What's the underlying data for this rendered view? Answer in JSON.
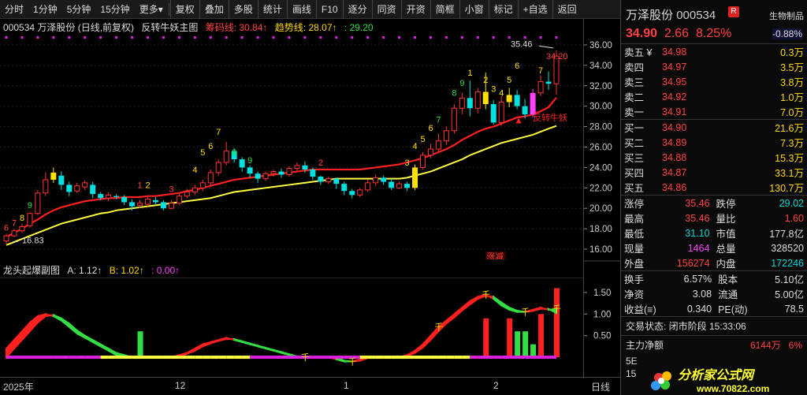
{
  "toolbar": {
    "items": [
      "分时",
      "1分钟",
      "5分钟",
      "15分钟",
      "更多"
    ],
    "more_arrow": "▾",
    "tools": [
      "复权",
      "叠加",
      "多股",
      "统计",
      "画线",
      "F10",
      "逐分",
      "同资",
      "开资",
      "简框",
      "小窗",
      "标记",
      "+自选",
      "返回"
    ]
  },
  "main": {
    "title": "000534 万泽股份 (日线,前复权)",
    "indicator": "反转牛妖主图",
    "line1": "筹码线: 30.84↑",
    "line2": "趋势线: 28.07↑",
    "line3": ": 29.20",
    "label_high": "35.46",
    "label_low": "16.83",
    "signal": "反转牛妖",
    "tag": "涨减",
    "nums": [
      "6",
      "7",
      "8",
      "9",
      "1",
      "2",
      "3",
      "4",
      "5",
      "6",
      "7",
      "8",
      "9",
      "2",
      "3",
      "4",
      "5",
      "6",
      "7",
      "8",
      "9",
      "1",
      "2",
      "3",
      "4",
      "5",
      "6",
      "7",
      "34.20"
    ],
    "arrow_up": "▲"
  },
  "sub": {
    "title": "龙头起爆副图",
    "a": "A: 1.12↑",
    "b": "B: 1.02↑",
    "c": ": 0.00↑",
    "mark": "千"
  },
  "axis_main": [
    "36.00",
    "34.00",
    "32.00",
    "30.00",
    "28.00",
    "26.00",
    "24.00",
    "22.00",
    "20.00",
    "18.00",
    "16.00"
  ],
  "axis_sub": [
    "1.50",
    "1.00",
    "0.50"
  ],
  "dates": [
    "2025年",
    "12",
    "1",
    "2",
    "日线"
  ],
  "quote": {
    "name": "万泽股份",
    "code": "000534",
    "badge": "R",
    "sector": "生物制品",
    "sector_chg": "-0.88%",
    "price": "34.90",
    "chg": "2.66",
    "pct": "8.25%",
    "asks": [
      {
        "label": "卖五 ¥",
        "price": "34.98",
        "vol": "0.3万"
      },
      {
        "label": "卖四",
        "price": "34.97",
        "vol": "3.5万"
      },
      {
        "label": "卖三",
        "price": "34.95",
        "vol": "3.8万"
      },
      {
        "label": "卖二",
        "price": "34.92",
        "vol": "1.0万"
      },
      {
        "label": "卖一",
        "price": "34.91",
        "vol": "7.0万"
      }
    ],
    "bids": [
      {
        "label": "买一",
        "price": "34.90",
        "vol": "21.6万"
      },
      {
        "label": "买二",
        "price": "34.89",
        "vol": "7.3万"
      },
      {
        "label": "买三",
        "price": "34.88",
        "vol": "15.3万"
      },
      {
        "label": "买四",
        "price": "34.87",
        "vol": "33.1万"
      },
      {
        "label": "买五",
        "price": "34.86",
        "vol": "130.7万"
      }
    ],
    "stats": [
      {
        "l1": "涨停",
        "v1": "35.46",
        "l2": "跌停",
        "v2": "29.02"
      },
      {
        "l1": "最高",
        "v1": "35.46",
        "l2": "量比",
        "v2": "1.60"
      },
      {
        "l1": "最低",
        "v1": "31.10",
        "l2": "市值",
        "v2": "177.8亿"
      },
      {
        "l1": "现量",
        "v1": "1464",
        "l2": "总量",
        "v2": "328520"
      },
      {
        "l1": "外盘",
        "v1": "156274",
        "l2": "内盘",
        "v2": "172246"
      }
    ],
    "stats2": [
      {
        "l1": "换手",
        "v1": "6.57%",
        "l2": "股本",
        "v2": "5.10亿"
      },
      {
        "l1": "净资",
        "v1": "3.08",
        "l2": "流通",
        "v2": "5.00亿"
      },
      {
        "l1": "收益(≡)",
        "v1": "0.340",
        "l2": "PE(动)",
        "v2": "78.5"
      }
    ],
    "status": "交易状态: 闭市阶段 15:33:06",
    "capital_label": "主力净额",
    "capital_value": "6144万",
    "capital_pct": "6%",
    "tail_5e": "5E",
    "tail_15": "15",
    "logo_text": "分析家公式网",
    "logo_url": "www.70822.com"
  },
  "chart_data": {
    "type": "candlestick",
    "xlabels": [
      "2025年",
      "12",
      "1",
      "2"
    ],
    "ylim": [
      15,
      37
    ],
    "candles": [
      [
        16.8,
        17.3,
        16.5,
        17.5
      ],
      [
        17.3,
        17.8,
        17.2,
        18.0
      ],
      [
        17.8,
        18.2,
        17.6,
        18.5
      ],
      [
        18.3,
        19.5,
        18.1,
        19.6
      ],
      [
        19.5,
        21.5,
        19.3,
        21.8
      ],
      [
        21.5,
        22.8,
        21.2,
        23.5
      ],
      [
        22.8,
        23.5,
        22.5,
        24.0
      ],
      [
        23.2,
        22.3,
        21.8,
        23.6
      ],
      [
        22.3,
        21.6,
        21.2,
        22.6
      ],
      [
        21.7,
        22.2,
        21.5,
        22.5
      ],
      [
        22.1,
        22.5,
        21.8,
        22.7
      ],
      [
        22.3,
        21.4,
        21.0,
        22.6
      ],
      [
        21.4,
        21.0,
        20.8,
        21.6
      ],
      [
        21.0,
        21.3,
        20.7,
        21.6
      ],
      [
        21.2,
        21.1,
        20.9,
        21.4
      ],
      [
        21.1,
        20.6,
        20.3,
        21.3
      ],
      [
        20.6,
        20.2,
        19.8,
        20.9
      ],
      [
        20.3,
        20.5,
        20.0,
        20.8
      ],
      [
        20.4,
        20.9,
        20.2,
        21.2
      ],
      [
        20.8,
        20.6,
        20.3,
        21.1
      ],
      [
        20.6,
        20.0,
        19.8,
        20.8
      ],
      [
        20.0,
        20.5,
        19.9,
        20.8
      ],
      [
        20.5,
        21.2,
        20.3,
        21.4
      ],
      [
        21.2,
        21.6,
        21.0,
        21.9
      ],
      [
        21.6,
        22.0,
        21.3,
        22.3
      ],
      [
        22.0,
        22.5,
        21.7,
        22.8
      ],
      [
        22.5,
        23.5,
        22.2,
        23.8
      ],
      [
        23.5,
        24.5,
        23.2,
        24.8
      ],
      [
        24.5,
        25.6,
        24.2,
        26.5
      ],
      [
        25.6,
        24.8,
        24.5,
        25.9
      ],
      [
        24.8,
        24.0,
        23.6,
        25.0
      ],
      [
        24.0,
        23.4,
        23.0,
        24.2
      ],
      [
        23.4,
        22.9,
        22.5,
        23.6
      ],
      [
        22.9,
        23.4,
        22.7,
        23.6
      ],
      [
        23.4,
        23.6,
        23.1,
        23.8
      ],
      [
        23.6,
        23.3,
        23.0,
        23.9
      ],
      [
        23.3,
        23.9,
        23.1,
        24.1
      ],
      [
        23.9,
        24.2,
        23.6,
        24.5
      ],
      [
        24.2,
        23.8,
        23.5,
        24.6
      ],
      [
        23.8,
        23.1,
        22.8,
        24.0
      ],
      [
        23.1,
        22.6,
        22.3,
        23.2
      ],
      [
        22.6,
        22.9,
        22.4,
        23.1
      ],
      [
        22.9,
        22.4,
        21.9,
        23.0
      ],
      [
        22.4,
        21.7,
        21.3,
        22.6
      ],
      [
        21.7,
        21.3,
        21.0,
        21.9
      ],
      [
        21.3,
        21.8,
        21.1,
        22.0
      ],
      [
        21.8,
        22.5,
        21.6,
        22.8
      ],
      [
        22.5,
        23.0,
        22.2,
        23.3
      ],
      [
        23.0,
        22.6,
        22.3,
        23.2
      ],
      [
        22.6,
        22.0,
        21.8,
        22.9
      ],
      [
        22.0,
        22.4,
        21.9,
        22.6
      ],
      [
        22.4,
        22.0,
        21.7,
        22.6
      ],
      [
        22.0,
        24.0,
        21.8,
        24.3
      ],
      [
        24.0,
        25.2,
        23.8,
        25.5
      ],
      [
        25.2,
        25.8,
        24.9,
        26.3
      ],
      [
        25.8,
        26.6,
        25.5,
        27.3
      ],
      [
        26.6,
        27.6,
        26.2,
        28.0
      ],
      [
        27.6,
        29.8,
        27.3,
        30.2
      ],
      [
        29.8,
        30.8,
        29.2,
        31.3
      ],
      [
        30.8,
        29.8,
        29.0,
        32.5
      ],
      [
        29.8,
        31.4,
        29.3,
        31.8
      ],
      [
        31.4,
        30.2,
        29.7,
        33.3
      ],
      [
        30.2,
        28.4,
        28.2,
        30.6
      ],
      [
        28.4,
        30.4,
        28.1,
        31.0
      ],
      [
        30.4,
        31.1,
        29.9,
        31.8
      ],
      [
        31.1,
        30.0,
        29.7,
        31.6
      ],
      [
        30.0,
        29.2,
        28.8,
        30.7
      ],
      [
        29.2,
        31.3,
        28.9,
        31.7
      ],
      [
        31.3,
        32.4,
        31.0,
        33.0
      ],
      [
        32.4,
        32.2,
        31.6,
        33.4
      ],
      [
        32.2,
        34.9,
        31.1,
        35.46
      ]
    ],
    "ma_red": [
      17.2,
      17.6,
      18.0,
      18.5,
      18.9,
      19.4,
      19.8,
      20.1,
      20.3,
      20.5,
      20.7,
      20.8,
      20.9,
      21.0,
      21.0,
      21.1,
      21.1,
      21.1,
      21.2,
      21.2,
      21.3,
      21.4,
      21.5,
      21.7,
      21.8,
      22.0,
      22.2,
      22.4,
      22.6,
      22.8,
      22.9,
      23.0,
      23.1,
      23.2,
      23.3,
      23.4,
      23.5,
      23.6,
      23.7,
      23.8,
      23.8,
      23.8,
      23.8,
      23.8,
      23.8,
      23.8,
      23.9,
      24.0,
      24.1,
      24.2,
      24.3,
      24.5,
      24.7,
      24.9,
      25.2,
      25.5,
      25.8,
      26.2,
      26.7,
      27.1,
      27.5,
      27.8,
      28.0,
      28.3,
      28.6,
      28.9,
      29.0,
      29.2,
      29.5,
      29.9,
      30.84
    ],
    "ma_yellow": [
      16.4,
      16.7,
      17.0,
      17.3,
      17.6,
      17.9,
      18.2,
      18.5,
      18.7,
      18.9,
      19.1,
      19.3,
      19.5,
      19.6,
      19.8,
      19.9,
      20.0,
      20.1,
      20.2,
      20.3,
      20.4,
      20.5,
      20.6,
      20.7,
      20.8,
      20.9,
      21.0,
      21.2,
      21.4,
      21.6,
      21.7,
      21.8,
      21.9,
      22.0,
      22.1,
      22.2,
      22.3,
      22.4,
      22.5,
      22.6,
      22.7,
      22.8,
      22.9,
      22.9,
      22.9,
      22.9,
      22.9,
      22.9,
      22.9,
      22.9,
      22.9,
      23.0,
      23.2,
      23.4,
      23.6,
      23.9,
      24.2,
      24.5,
      24.8,
      25.2,
      25.5,
      25.8,
      26.1,
      26.4,
      26.6,
      26.8,
      27.0,
      27.2,
      27.5,
      27.8,
      28.07
    ],
    "ma_red_name": "筹码线",
    "ma_yellow_name": "趋势线",
    "sub": {
      "a": [
        0.2,
        0.4,
        0.6,
        0.8,
        0.95,
        1.0,
        0.95,
        0.85,
        0.7,
        0.55,
        0.45,
        0.35,
        0.25,
        0.15,
        0.05,
        0.0,
        0.0,
        0.0,
        0.0,
        0.0,
        0.0,
        0.0,
        0.05,
        0.1,
        0.2,
        0.3,
        0.35,
        0.4,
        0.45,
        0.4,
        0.35,
        0.3,
        0.25,
        0.2,
        0.15,
        0.1,
        0.05,
        0.0,
        0.0,
        0.0,
        0.0,
        0.0,
        -0.05,
        -0.1,
        -0.1,
        -0.05,
        0.0,
        0.0,
        0.0,
        0.0,
        0.0,
        0.05,
        0.15,
        0.3,
        0.5,
        0.7,
        0.85,
        1.0,
        1.15,
        1.3,
        1.4,
        1.45,
        1.35,
        1.2,
        1.1,
        1.05,
        1.05,
        1.1,
        1.15,
        1.1,
        1.12
      ],
      "b": [
        0.0,
        0.2,
        0.4,
        0.6,
        0.8,
        0.95,
        0.98,
        0.9,
        0.78,
        0.62,
        0.5,
        0.4,
        0.3,
        0.2,
        0.1,
        0.05,
        0.0,
        0.0,
        0.0,
        0.0,
        0.0,
        0.0,
        0.0,
        0.08,
        0.15,
        0.25,
        0.32,
        0.38,
        0.42,
        0.42,
        0.37,
        0.32,
        0.27,
        0.22,
        0.17,
        0.12,
        0.07,
        0.02,
        0.0,
        0.0,
        0.0,
        0.0,
        0.0,
        -0.08,
        -0.1,
        -0.08,
        -0.02,
        0.0,
        0.0,
        0.0,
        0.0,
        0.02,
        0.1,
        0.22,
        0.4,
        0.6,
        0.78,
        0.92,
        1.08,
        1.22,
        1.35,
        1.42,
        1.4,
        1.27,
        1.15,
        1.08,
        1.05,
        1.07,
        1.12,
        1.12,
        1.02
      ],
      "bars_green": [
        [
          17,
          0.6
        ],
        [
          65,
          0.6
        ],
        [
          66,
          0.6
        ],
        [
          67,
          0.3
        ]
      ],
      "bars_red": [
        [
          61,
          0.9
        ],
        [
          64,
          0.9
        ],
        [
          68,
          1.0
        ],
        [
          70,
          1.6
        ]
      ],
      "marks": [
        38,
        44,
        55,
        61,
        66,
        70
      ],
      "ylim": [
        -0.2,
        1.7
      ]
    }
  }
}
